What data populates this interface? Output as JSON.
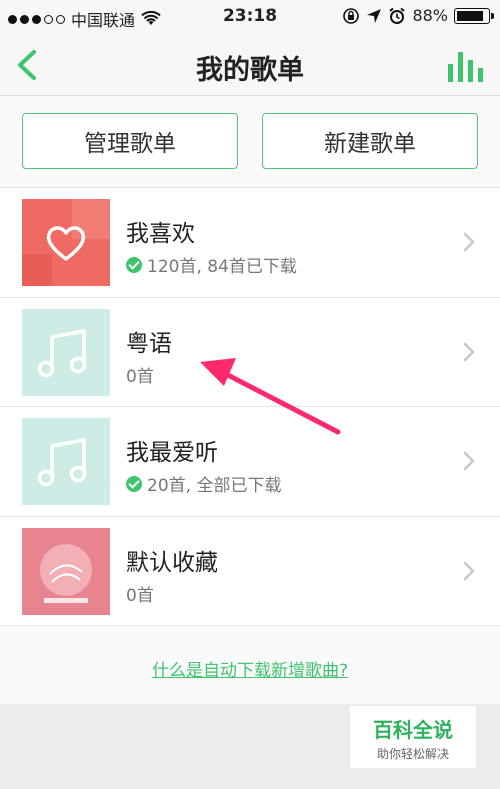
{
  "status_bar": {
    "carrier": "中国联通",
    "time": "23:18",
    "battery": "88%",
    "battery_level": 0.88
  },
  "nav": {
    "title": "我的歌单",
    "back_icon": "chevron-left-icon",
    "right_icon": "equalizer-icon"
  },
  "actions": {
    "manage_label": "管理歌单",
    "create_label": "新建歌单"
  },
  "playlists": [
    {
      "name": "我喜欢",
      "meta": "120首, 84首已下载",
      "downloaded": true,
      "cover": "heart"
    },
    {
      "name": "粤语",
      "meta": "0首",
      "downloaded": false,
      "cover": "note"
    },
    {
      "name": "我最爱听",
      "meta": "20首, 全部已下载",
      "downloaded": true,
      "cover": "note"
    },
    {
      "name": "默认收藏",
      "meta": "0首",
      "downloaded": false,
      "cover": "pink-photo"
    }
  ],
  "auto_download_link": "什么是自动下载新增歌曲?",
  "watermark": {
    "title": "百科全说",
    "subtitle": "助你轻松解决"
  },
  "colors": {
    "accent": "#3ec46d",
    "arrow": "#ff2a6d",
    "note_cover": "#cdece6",
    "heart_cover": "#ee6a63"
  }
}
